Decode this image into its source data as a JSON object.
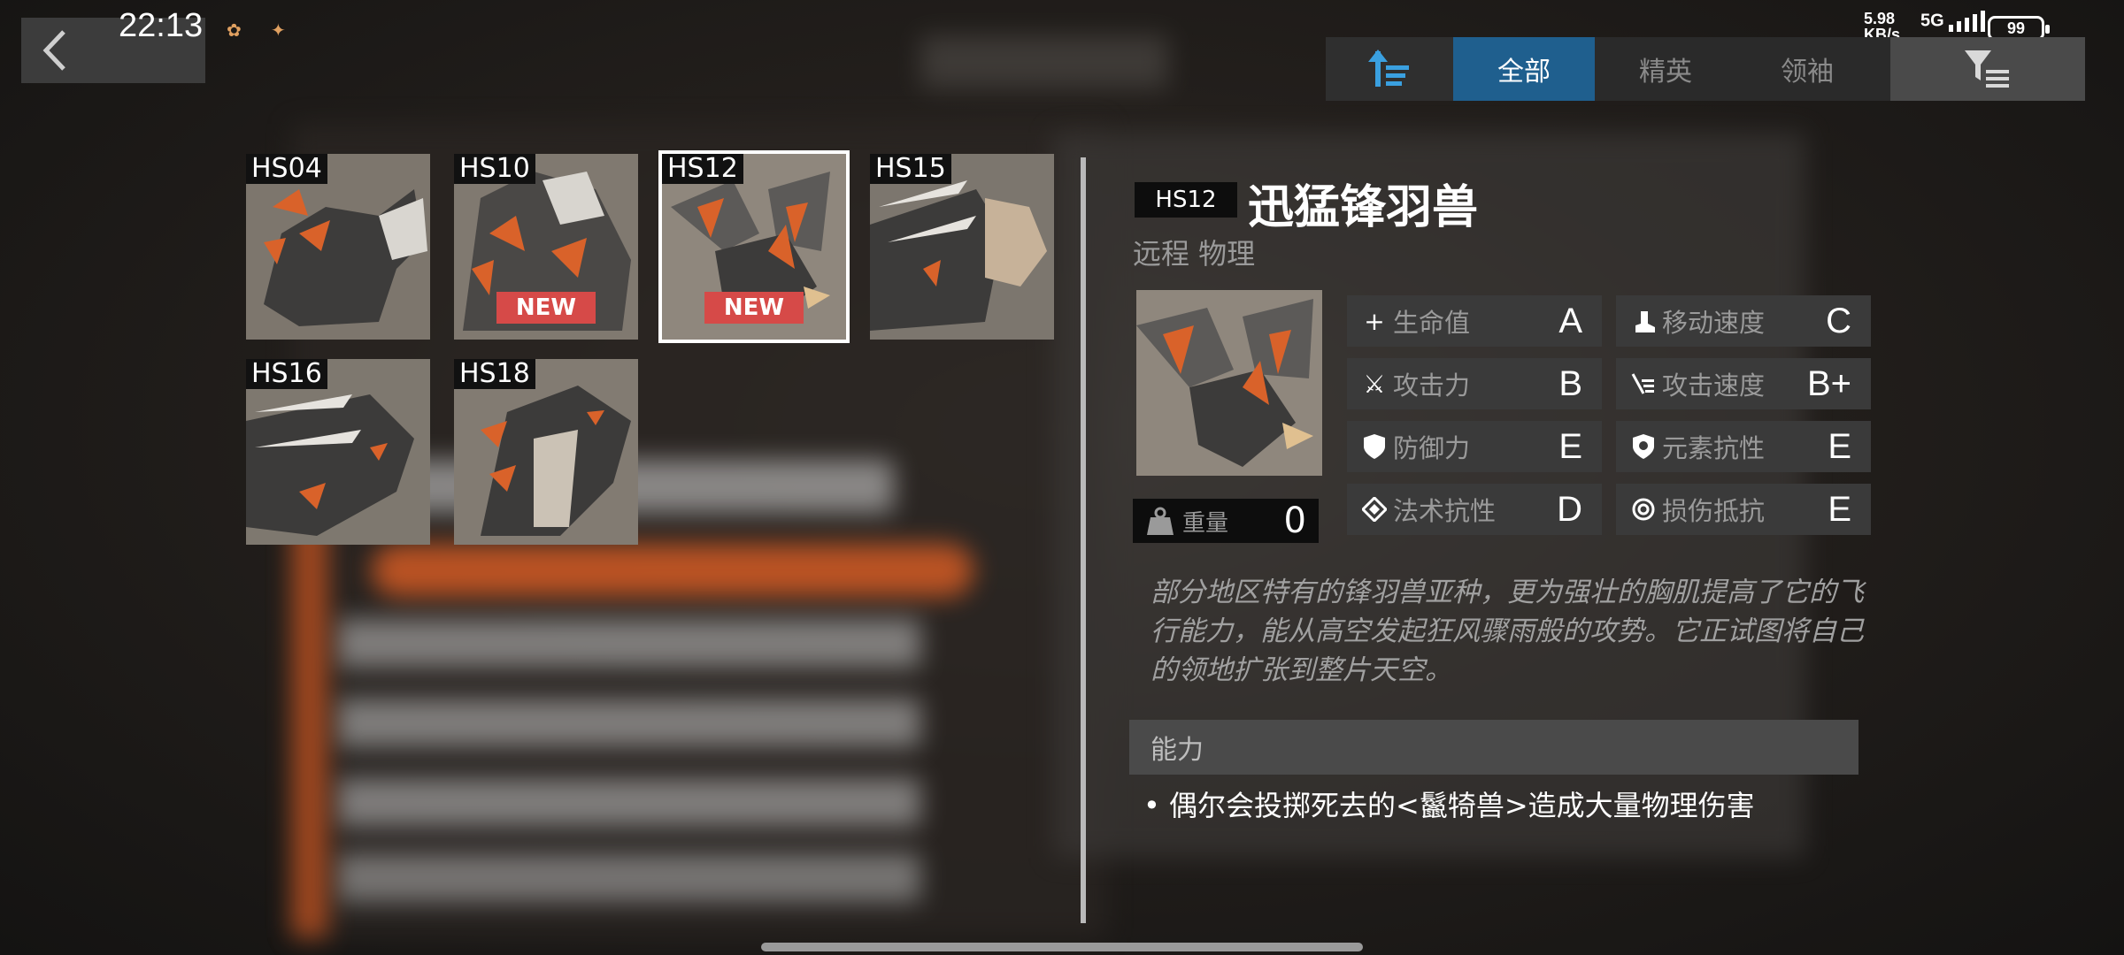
{
  "status_bar": {
    "time": "22:13",
    "net_speed_value": "5.98",
    "net_speed_unit": "KB/s",
    "network": "5G",
    "battery": "99"
  },
  "tabs": {
    "items": [
      {
        "label": "全部",
        "active": true
      },
      {
        "label": "精英",
        "active": false
      },
      {
        "label": "领袖",
        "active": false
      }
    ],
    "active_color": "#1f5f8e"
  },
  "enemies": [
    {
      "code": "HS04",
      "new": false,
      "selected": false
    },
    {
      "code": "HS10",
      "new": true,
      "selected": false
    },
    {
      "code": "HS12",
      "new": true,
      "selected": true
    },
    {
      "code": "HS15",
      "new": false,
      "selected": false
    },
    {
      "code": "HS16",
      "new": false,
      "selected": false
    },
    {
      "code": "HS18",
      "new": false,
      "selected": false
    }
  ],
  "new_badge": "NEW",
  "detail": {
    "code": "HS12",
    "name": "迅猛锋羽兽",
    "type": "远程 物理",
    "weight_label": "重量",
    "weight_value": "0",
    "stats": [
      {
        "icon": "plus-icon",
        "label": "生命值",
        "grade": "A"
      },
      {
        "icon": "boot-icon",
        "label": "移动速度",
        "grade": "C"
      },
      {
        "icon": "crossed-swords-icon",
        "label": "攻击力",
        "grade": "B"
      },
      {
        "icon": "attack-speed-icon",
        "label": "攻击速度",
        "grade": "B+"
      },
      {
        "icon": "shield-icon",
        "label": "防御力",
        "grade": "E"
      },
      {
        "icon": "element-shield-icon",
        "label": "元素抗性",
        "grade": "E"
      },
      {
        "icon": "diamond-icon",
        "label": "法术抗性",
        "grade": "D"
      },
      {
        "icon": "ring-icon",
        "label": "损伤抵抗",
        "grade": "E"
      }
    ],
    "description": "部分地区特有的锋羽兽亚种，更为强壮的胸肌提高了它的飞行能力，能从高空发起狂风骤雨般的攻势。它正试图将自己的领地扩张到整片天空。",
    "ability_header": "能力",
    "ability_text": "偶尔会投掷死去的<鬣犄兽>造成大量物理伤害"
  }
}
